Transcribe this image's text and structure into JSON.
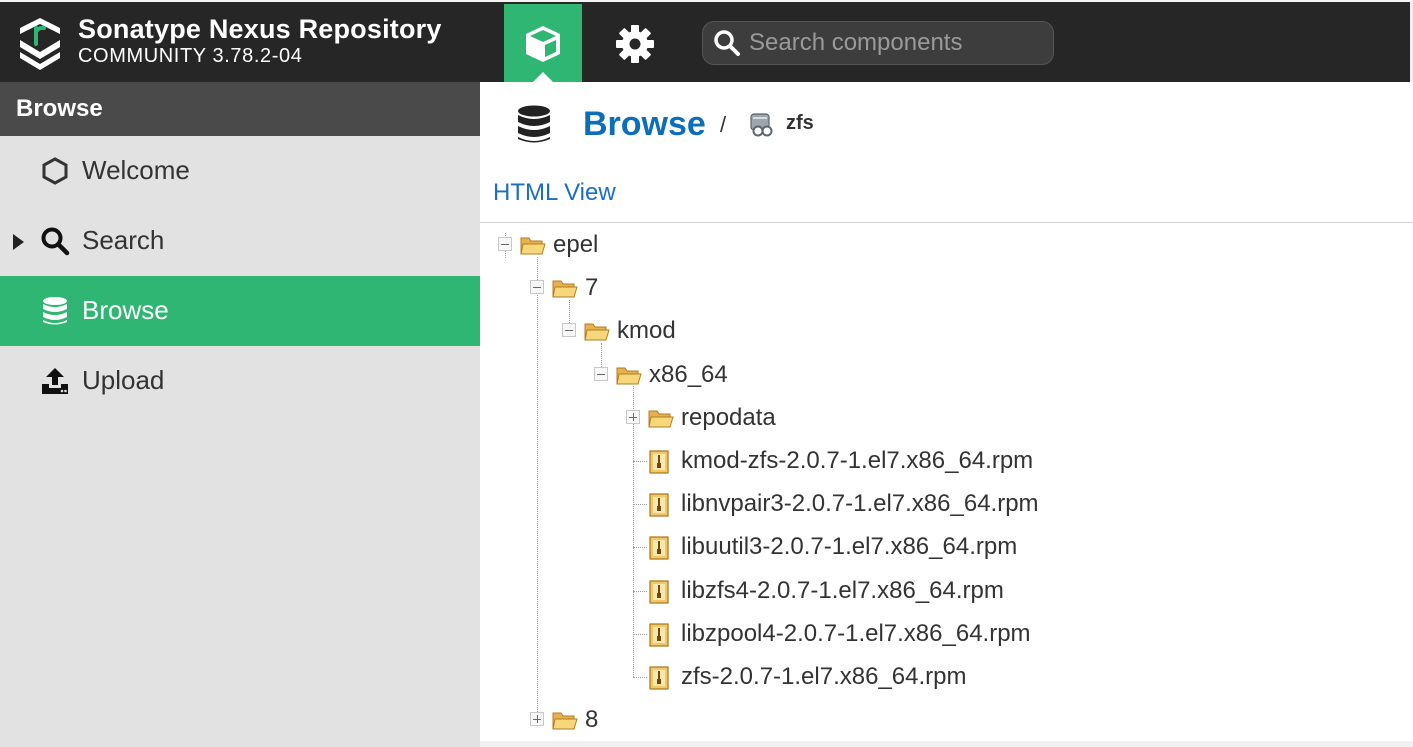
{
  "header": {
    "app_title": "Sonatype Nexus Repository",
    "edition": "COMMUNITY 3.78.2-04",
    "search": {
      "placeholder": "Search components",
      "value": ""
    }
  },
  "sidebar": {
    "title": "Browse",
    "items": [
      {
        "label": "Welcome",
        "icon": "hexagon-icon",
        "active": false,
        "expandable": false
      },
      {
        "label": "Search",
        "icon": "search-icon",
        "active": false,
        "expandable": true
      },
      {
        "label": "Browse",
        "icon": "database-icon",
        "active": true,
        "expandable": false
      },
      {
        "label": "Upload",
        "icon": "upload-icon",
        "active": false,
        "expandable": false
      }
    ]
  },
  "breadcrumb": {
    "section": "Browse",
    "separator": "/",
    "repository": "zfs"
  },
  "html_view_link": "HTML View",
  "tree": [
    {
      "label": "epel",
      "type": "folder",
      "expanded": true
    },
    {
      "label": "7",
      "type": "folder",
      "expanded": true
    },
    {
      "label": "kmod",
      "type": "folder",
      "expanded": true
    },
    {
      "label": "x86_64",
      "type": "folder",
      "expanded": true
    },
    {
      "label": "repodata",
      "type": "folder",
      "expanded": false
    },
    {
      "label": "kmod-zfs-2.0.7-1.el7.x86_64.rpm",
      "type": "file"
    },
    {
      "label": "libnvpair3-2.0.7-1.el7.x86_64.rpm",
      "type": "file"
    },
    {
      "label": "libuutil3-2.0.7-1.el7.x86_64.rpm",
      "type": "file"
    },
    {
      "label": "libzfs4-2.0.7-1.el7.x86_64.rpm",
      "type": "file"
    },
    {
      "label": "libzpool4-2.0.7-1.el7.x86_64.rpm",
      "type": "file"
    },
    {
      "label": "zfs-2.0.7-1.el7.x86_64.rpm",
      "type": "file"
    },
    {
      "label": "8",
      "type": "folder",
      "expanded": false
    }
  ],
  "colors": {
    "accent_green": "#2fb673",
    "topbar_bg": "#262626",
    "link_blue": "#0c6ebb",
    "sidebar_bg": "#e2e2e2"
  }
}
